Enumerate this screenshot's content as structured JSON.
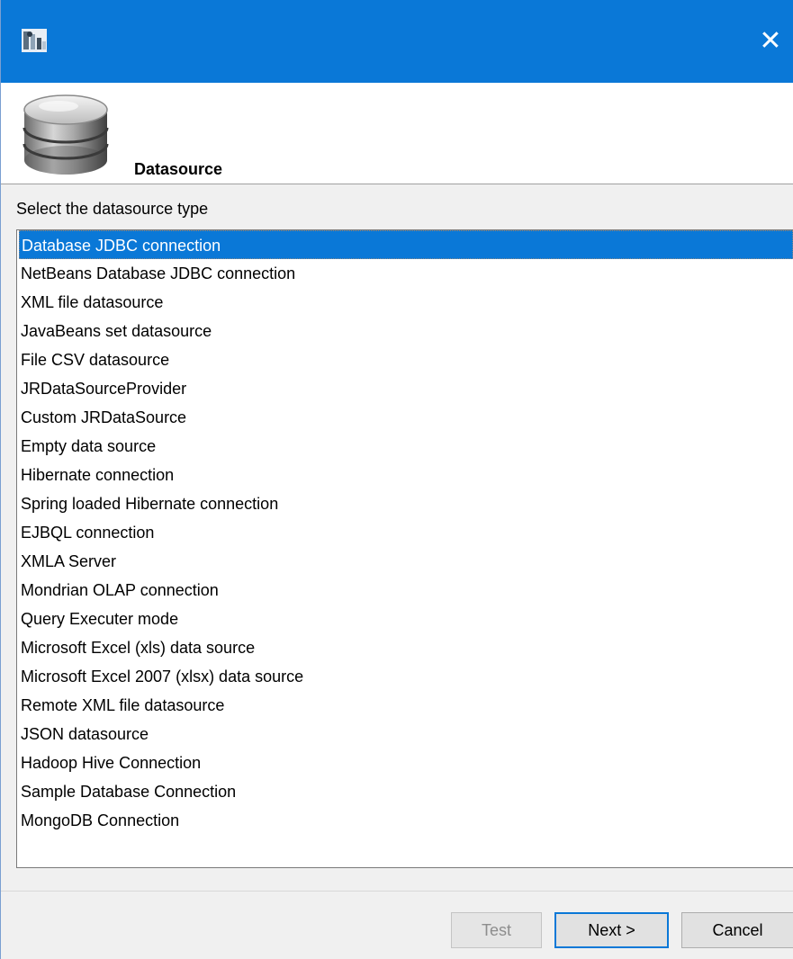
{
  "window": {
    "icon": "app-icon",
    "close_glyph": "✕"
  },
  "header": {
    "icon": "database-icon",
    "title": "Datasource"
  },
  "prompt": "Select the datasource type",
  "datasource_types": [
    "Database JDBC connection",
    "NetBeans Database JDBC connection",
    "XML file datasource",
    "JavaBeans set datasource",
    "File CSV datasource",
    "JRDataSourceProvider",
    "Custom JRDataSource",
    "Empty data source",
    "Hibernate connection",
    "Spring loaded Hibernate connection",
    "EJBQL connection",
    "XMLA Server",
    "Mondrian OLAP connection",
    "Query Executer mode",
    "Microsoft Excel (xls) data source",
    "Microsoft Excel 2007 (xlsx) data source",
    "Remote XML file datasource",
    "JSON datasource",
    "Hadoop Hive Connection",
    "Sample Database Connection",
    "MongoDB Connection"
  ],
  "selected_index": 0,
  "buttons": {
    "test": "Test",
    "next": "Next >",
    "cancel": "Cancel"
  },
  "colors": {
    "titlebar": "#0a78d7",
    "selection": "#0a78d7"
  }
}
